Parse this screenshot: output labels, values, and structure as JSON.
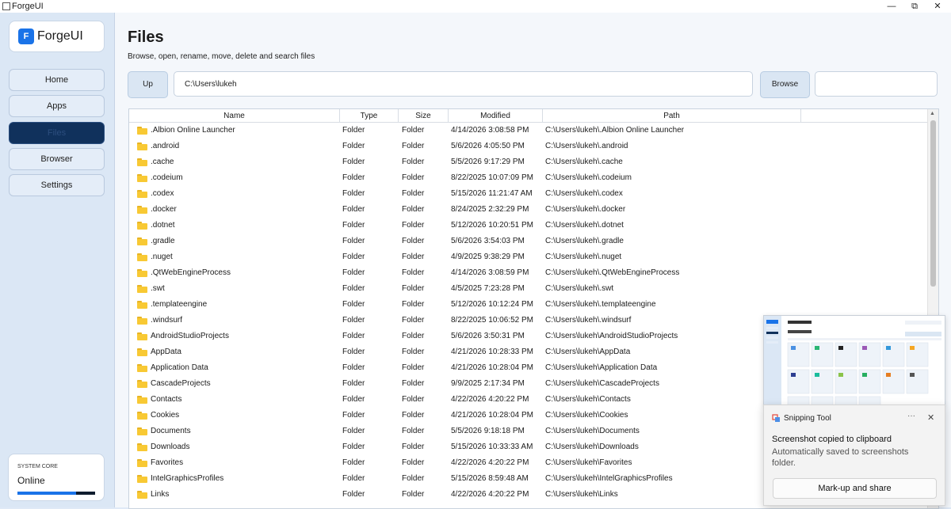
{
  "window": {
    "title": "ForgeUI",
    "controls": {
      "minimize": "—",
      "maximize": "⧉",
      "close": "✕"
    }
  },
  "sidebar": {
    "logo_letter": "F",
    "logo_text": "ForgeUI",
    "items": [
      {
        "label": "Home",
        "active": false
      },
      {
        "label": "Apps",
        "active": false
      },
      {
        "label": "Files",
        "active": true
      },
      {
        "label": "Browser",
        "active": false
      },
      {
        "label": "Settings",
        "active": false
      }
    ],
    "core": {
      "label": "SYSTEM CORE",
      "status": "Online",
      "progress": 0.75
    }
  },
  "page": {
    "title": "Files",
    "subtitle": "Browse, open, rename, move, delete and search files",
    "up_label": "Up",
    "path_value": "C:\\Users\\lukeh",
    "browse_label": "Browse",
    "search_value": ""
  },
  "table": {
    "columns": [
      "Name",
      "Type",
      "Size",
      "Modified",
      "Path"
    ],
    "rows": [
      [
        ".Albion Online Launcher",
        "Folder",
        "Folder",
        "4/14/2026 3:08:58 PM",
        "C:\\Users\\lukeh\\.Albion Online Launcher"
      ],
      [
        ".android",
        "Folder",
        "Folder",
        "5/6/2026 4:05:50 PM",
        "C:\\Users\\lukeh\\.android"
      ],
      [
        ".cache",
        "Folder",
        "Folder",
        "5/5/2026 9:17:29 PM",
        "C:\\Users\\lukeh\\.cache"
      ],
      [
        ".codeium",
        "Folder",
        "Folder",
        "8/22/2025 10:07:09 PM",
        "C:\\Users\\lukeh\\.codeium"
      ],
      [
        ".codex",
        "Folder",
        "Folder",
        "5/15/2026 11:21:47 AM",
        "C:\\Users\\lukeh\\.codex"
      ],
      [
        ".docker",
        "Folder",
        "Folder",
        "8/24/2025 2:32:29 PM",
        "C:\\Users\\lukeh\\.docker"
      ],
      [
        ".dotnet",
        "Folder",
        "Folder",
        "5/12/2026 10:20:51 PM",
        "C:\\Users\\lukeh\\.dotnet"
      ],
      [
        ".gradle",
        "Folder",
        "Folder",
        "5/6/2026 3:54:03 PM",
        "C:\\Users\\lukeh\\.gradle"
      ],
      [
        ".nuget",
        "Folder",
        "Folder",
        "4/9/2025 9:38:29 PM",
        "C:\\Users\\lukeh\\.nuget"
      ],
      [
        ".QtWebEngineProcess",
        "Folder",
        "Folder",
        "4/14/2026 3:08:59 PM",
        "C:\\Users\\lukeh\\.QtWebEngineProcess"
      ],
      [
        ".swt",
        "Folder",
        "Folder",
        "4/5/2025 7:23:28 PM",
        "C:\\Users\\lukeh\\.swt"
      ],
      [
        ".templateengine",
        "Folder",
        "Folder",
        "5/12/2026 10:12:24 PM",
        "C:\\Users\\lukeh\\.templateengine"
      ],
      [
        ".windsurf",
        "Folder",
        "Folder",
        "8/22/2025 10:06:52 PM",
        "C:\\Users\\lukeh\\.windsurf"
      ],
      [
        "AndroidStudioProjects",
        "Folder",
        "Folder",
        "5/6/2026 3:50:31 PM",
        "C:\\Users\\lukeh\\AndroidStudioProjects"
      ],
      [
        "AppData",
        "Folder",
        "Folder",
        "4/21/2026 10:28:33 PM",
        "C:\\Users\\lukeh\\AppData"
      ],
      [
        "Application Data",
        "Folder",
        "Folder",
        "4/21/2026 10:28:04 PM",
        "C:\\Users\\lukeh\\Application Data"
      ],
      [
        "CascadeProjects",
        "Folder",
        "Folder",
        "9/9/2025 2:17:34 PM",
        "C:\\Users\\lukeh\\CascadeProjects"
      ],
      [
        "Contacts",
        "Folder",
        "Folder",
        "4/22/2026 4:20:22 PM",
        "C:\\Users\\lukeh\\Contacts"
      ],
      [
        "Cookies",
        "Folder",
        "Folder",
        "4/21/2026 10:28:04 PM",
        "C:\\Users\\lukeh\\Cookies"
      ],
      [
        "Documents",
        "Folder",
        "Folder",
        "5/5/2026 9:18:18 PM",
        "C:\\Users\\lukeh\\Documents"
      ],
      [
        "Downloads",
        "Folder",
        "Folder",
        "5/15/2026 10:33:33 AM",
        "C:\\Users\\lukeh\\Downloads"
      ],
      [
        "Favorites",
        "Folder",
        "Folder",
        "4/22/2026 4:20:22 PM",
        "C:\\Users\\lukeh\\Favorites"
      ],
      [
        "IntelGraphicsProfiles",
        "Folder",
        "Folder",
        "5/15/2026 8:59:48 AM",
        "C:\\Users\\lukeh\\IntelGraphicsProfiles"
      ],
      [
        "Links",
        "Folder",
        "Folder",
        "4/22/2026 4:20:22 PM",
        "C:\\Users\\lukeh\\Links"
      ]
    ]
  },
  "toast": {
    "app": "Snipping Tool",
    "more": "···",
    "close": "✕",
    "title": "Screenshot copied to clipboard",
    "body": "Automatically saved to screenshots folder.",
    "action": "Mark-up and share"
  },
  "colors": {
    "accent": "#1a73e8",
    "active_nav": "#10315c",
    "folder": "#f8c934"
  }
}
